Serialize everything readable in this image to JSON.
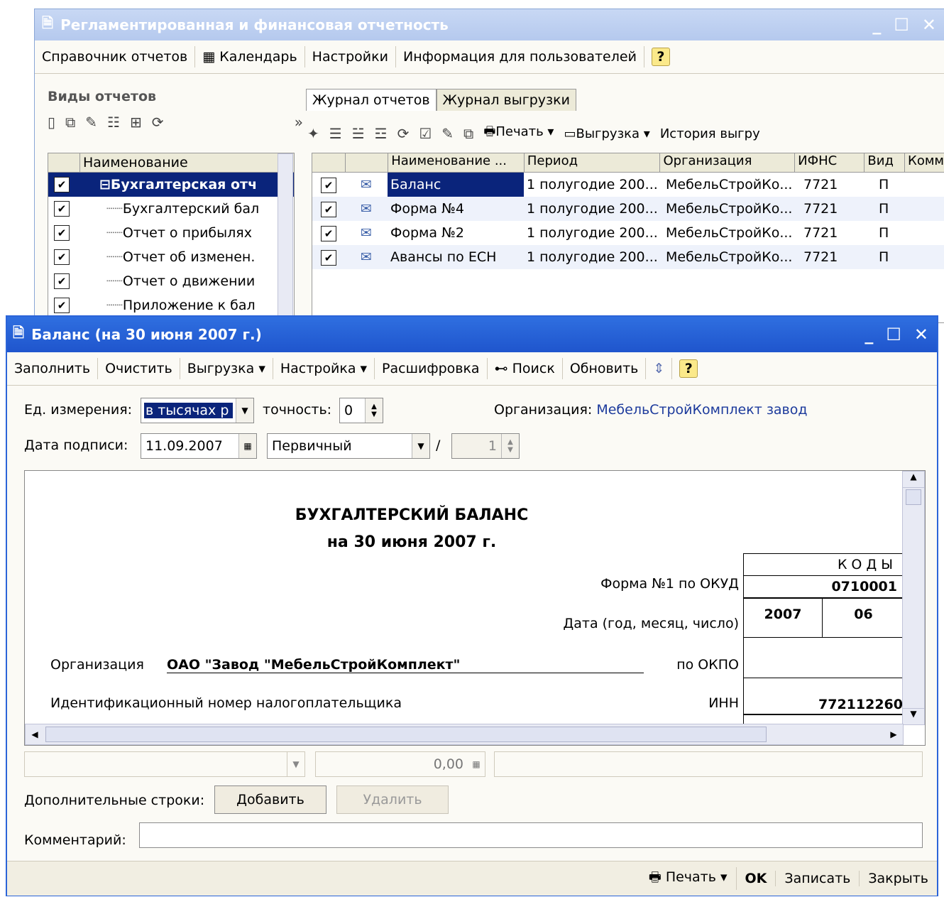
{
  "back_window": {
    "title": "Регламентированная и финансовая отчетность",
    "menu": [
      "Справочник отчетов",
      "Календарь",
      "Настройки",
      "Информация для пользователей"
    ],
    "left_panel": {
      "title": "Виды отчетов",
      "column": "Наименование",
      "items": [
        "Бухгалтерская отч",
        "Бухгалтерский бал",
        "Отчет о прибылях",
        "Отчет об изменен.",
        "Отчет о движении",
        "Приложение к бал"
      ]
    },
    "tabs": [
      "Журнал отчетов",
      "Журнал выгрузки"
    ],
    "toolbar": {
      "print": "Печать",
      "export": "Выгрузка",
      "history": "История выгру"
    },
    "table": {
      "headers": [
        "Наименование ...",
        "Период",
        "Организация",
        "ИФНС",
        "Вид",
        "Комм"
      ],
      "rows": [
        {
          "name": "Баланс",
          "period": "1 полугодие 200...",
          "org": "МебельСтройКо...",
          "ifns": "7721",
          "kind": "П"
        },
        {
          "name": "Форма №4",
          "period": "1 полугодие 200...",
          "org": "МебельСтройКо...",
          "ifns": "7721",
          "kind": "П"
        },
        {
          "name": "Форма №2",
          "period": "1 полугодие 200...",
          "org": "МебельСтройКо...",
          "ifns": "7721",
          "kind": "П"
        },
        {
          "name": "Авансы по ЕСН",
          "period": "1 полугодие 200...",
          "org": "МебельСтройКо...",
          "ifns": "7721",
          "kind": "П"
        }
      ]
    }
  },
  "front_window": {
    "title": "Баланс (на 30 июня 2007 г.)",
    "toolbar": [
      "Заполнить",
      "Очистить",
      "Выгрузка",
      "Настройка",
      "Расшифровка",
      "Поиск",
      "Обновить"
    ],
    "units_label": "Ед. измерения:",
    "units_value": "в тысячах р",
    "precision_label": "точность:",
    "precision_value": "0",
    "org_label": "Организация:",
    "org_value": "МебельСтройКомплект завод",
    "sign_date_label": "Дата подписи:",
    "sign_date_value": "11.09.2007",
    "type_value": "Первичный",
    "slash": "/",
    "correction_value": "1",
    "doc": {
      "title": "БУХГАЛТЕРСКИЙ БАЛАНС",
      "subtitle": "на 30 июня 2007 г.",
      "codes_header": "КОДЫ",
      "form_label": "Форма №1 по ОКУД",
      "form_code": "0710001",
      "date_label": "Дата (год, месяц, число)",
      "year": "2007",
      "month": "06",
      "org_label": "Организация",
      "org_name": "ОАО \"Завод \"МебельСтройКомплект\"",
      "okpo_label": "по ОКПО",
      "inn_label_long": "Идентификационный номер налогоплательщика",
      "inn_label": "ИНН",
      "inn_value": "772112260"
    },
    "amount_value": "0,00",
    "extra_rows_label": "Дополнительные строки:",
    "add_button": "Добавить",
    "delete_button": "Удалить",
    "comment_label": "Комментарий:",
    "footer": {
      "print": "Печать",
      "ok": "OK",
      "save": "Записать",
      "close": "Закрыть"
    }
  }
}
